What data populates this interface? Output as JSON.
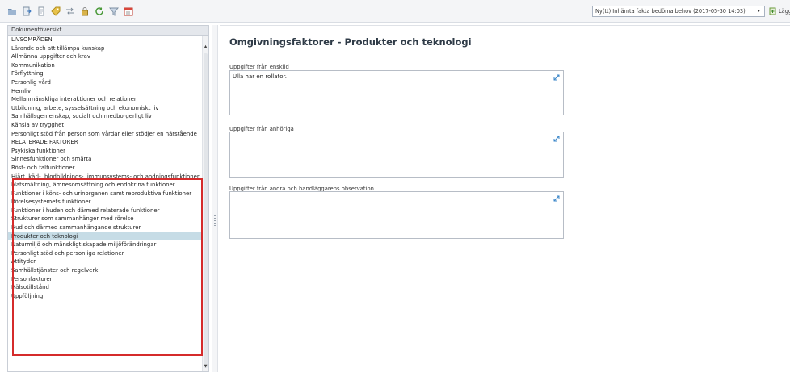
{
  "toolbar": {
    "icons": [
      "open-icon",
      "export-icon",
      "document-icon",
      "tag-icon",
      "transfer-icon",
      "lock-icon",
      "refresh-icon",
      "filter-icon",
      "calendar-icon"
    ],
    "select_value": "Ny(tt) Inhämta fakta bedöma behov (2017-05-30 14:03)",
    "add_label": "Lägg"
  },
  "sidebar": {
    "header": "Dokumentöversikt",
    "items": [
      "LIVSOMRÅDEN",
      "Lärande och att tillämpa kunskap",
      "Allmänna uppgifter och krav",
      "Kommunikation",
      "Förflyttning",
      "Personlig vård",
      "Hemliv",
      "Mellanmänskliga interaktioner och relationer",
      "Utbildning, arbete, sysselsättning och ekonomiskt liv",
      "Samhällsgemenskap, socialt och medborgerligt liv",
      "Känsla av trygghet",
      "Personligt stöd från person som vårdar eller stödjer en närstående",
      "RELATERADE FAKTORER",
      "Psykiska funktioner",
      "Sinnesfunktioner och smärta",
      "Röst- och talfunktioner",
      "Hjärt, kärl-, blodbildnings-, immunsystems- och andningsfunktioner",
      "Matsmältning, ämnesomsättning och endokrina funktioner",
      "Funktioner i köns- och urinorganen samt reproduktiva funktioner",
      "Rörelsesystemets funktioner",
      "Funktioner i huden och därmed relaterade funktioner",
      "Strukturer som sammanhänger med rörelse",
      "Hud och därmed sammanhängande strukturer",
      "Produkter och teknologi",
      "Naturmiljö och mänskligt skapade miljöförändringar",
      "Personligt stöd och personliga relationer",
      "Attityder",
      "Samhällstjänster och regelverk",
      "Personfaktorer",
      "Hälsotillstånd",
      "Uppföljning"
    ],
    "selected_index": 23
  },
  "main": {
    "title": "Omgivningsfaktorer - Produkter och teknologi",
    "fields": [
      {
        "label": "Uppgifter från enskild",
        "value": "Ulla har en rollator."
      },
      {
        "label": "Uppgifter från anhöriga",
        "value": ""
      },
      {
        "label": "Uppgifter från andra och handläggarens observation",
        "value": ""
      }
    ]
  },
  "colors": {
    "highlight_border": "#d52b2b",
    "selected_row": "#c6dce6",
    "title": "#2f3b47"
  }
}
